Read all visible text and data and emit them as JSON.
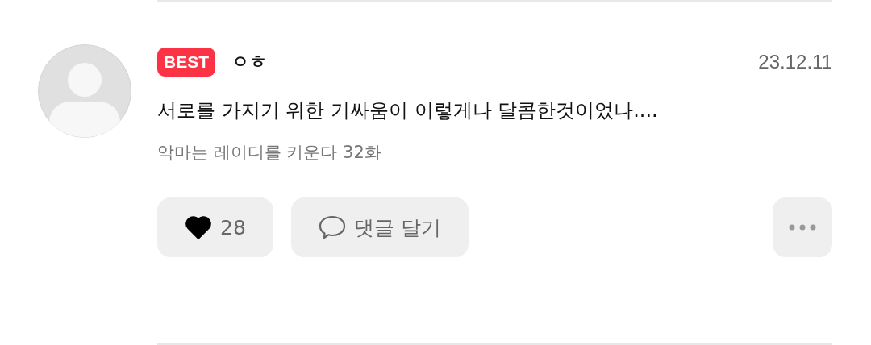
{
  "comment": {
    "badge": "BEST",
    "author": "ㅇㅎ",
    "date": "23.12.11",
    "text": "서로를 가지기 위한 기싸움이 이렇게나 달콤한것이었나....",
    "episode": "악마는 레이디를 키운다 32화",
    "like": {
      "count": "28",
      "liked": true
    },
    "reply_button": "댓글 달기"
  }
}
